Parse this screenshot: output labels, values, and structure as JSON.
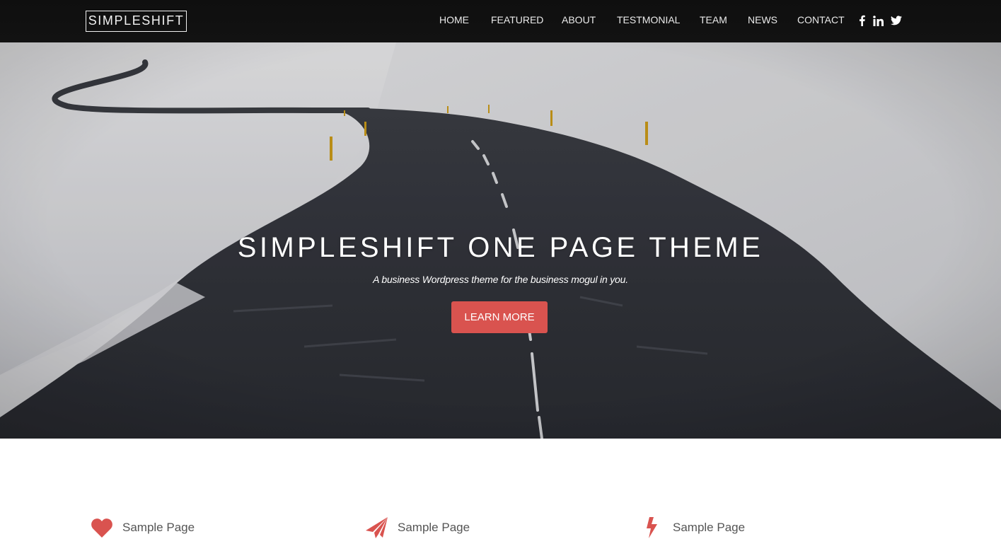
{
  "brand": {
    "name": "SIMPLESHIFT"
  },
  "nav": {
    "items": [
      {
        "label": "HOME"
      },
      {
        "label": "FEATURED"
      },
      {
        "label": "ABOUT"
      },
      {
        "label": "TESTMONIAL"
      },
      {
        "label": "TEAM"
      },
      {
        "label": "NEWS"
      },
      {
        "label": "CONTACT"
      }
    ],
    "social": [
      {
        "icon": "facebook-icon"
      },
      {
        "icon": "linkedin-icon"
      },
      {
        "icon": "twitter-icon"
      }
    ]
  },
  "hero": {
    "title": "SIMPLESHIFT ONE PAGE THEME",
    "subtitle": "A business Wordpress theme for the business mogul in you.",
    "button_label": "LEARN MORE",
    "background": "snowy winding road photograph"
  },
  "features": [
    {
      "icon": "heart-icon",
      "label": "Sample Page"
    },
    {
      "icon": "paper-plane-icon",
      "label": "Sample Page"
    },
    {
      "icon": "bolt-icon",
      "label": "Sample Page"
    }
  ],
  "colors": {
    "accent": "#d9534f",
    "navbar_bg": "#111111",
    "feature_text": "#555555"
  }
}
